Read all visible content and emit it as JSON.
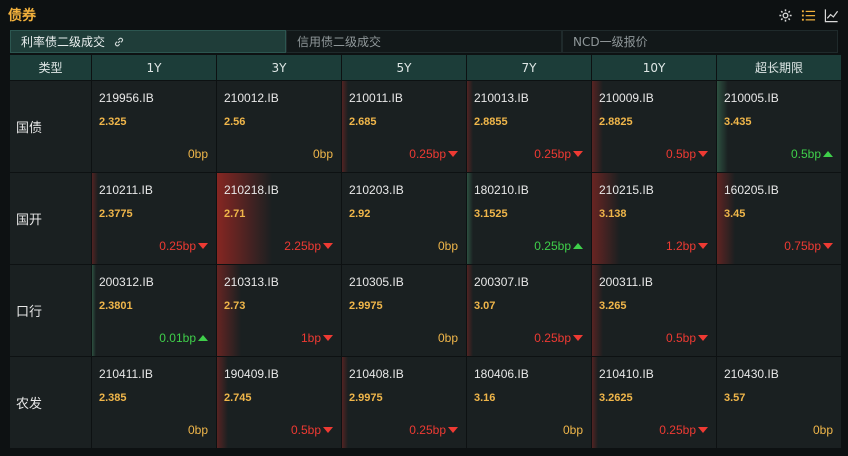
{
  "header": {
    "title": "债券"
  },
  "tabs": [
    {
      "label": "利率债二级成交",
      "active": true
    },
    {
      "label": "信用债二级成交",
      "active": false
    },
    {
      "label": "NCD一级报价",
      "active": false
    }
  ],
  "columns": [
    "类型",
    "1Y",
    "3Y",
    "5Y",
    "7Y",
    "10Y",
    "超长期限"
  ],
  "rows": [
    {
      "label": "国债",
      "cells": [
        {
          "code": "219956.IB",
          "yield": "2.325",
          "chg": "0bp",
          "dir": "flat",
          "intensity": 0
        },
        {
          "code": "210012.IB",
          "yield": "2.56",
          "chg": "0bp",
          "dir": "flat",
          "intensity": 0
        },
        {
          "code": "210011.IB",
          "yield": "2.685",
          "chg": "0.25bp",
          "dir": "down",
          "intensity": 0.1
        },
        {
          "code": "210013.IB",
          "yield": "2.8855",
          "chg": "0.25bp",
          "dir": "down",
          "intensity": 0.1
        },
        {
          "code": "210009.IB",
          "yield": "2.8825",
          "chg": "0.5bp",
          "dir": "down",
          "intensity": 0.2
        },
        {
          "code": "210005.IB",
          "yield": "3.435",
          "chg": "0.5bp",
          "dir": "up",
          "intensity": 0.2
        }
      ]
    },
    {
      "label": "国开",
      "cells": [
        {
          "code": "210211.IB",
          "yield": "2.3775",
          "chg": "0.25bp",
          "dir": "down",
          "intensity": 0.1
        },
        {
          "code": "210218.IB",
          "yield": "2.71",
          "chg": "2.25bp",
          "dir": "down",
          "intensity": 1.0
        },
        {
          "code": "210203.IB",
          "yield": "2.92",
          "chg": "0bp",
          "dir": "flat",
          "intensity": 0
        },
        {
          "code": "180210.IB",
          "yield": "3.1525",
          "chg": "0.25bp",
          "dir": "up",
          "intensity": 0.1
        },
        {
          "code": "210215.IB",
          "yield": "3.138",
          "chg": "1.2bp",
          "dir": "down",
          "intensity": 0.5
        },
        {
          "code": "160205.IB",
          "yield": "3.45",
          "chg": "0.75bp",
          "dir": "down",
          "intensity": 0.33
        }
      ]
    },
    {
      "label": "口行",
      "cells": [
        {
          "code": "200312.IB",
          "yield": "2.3801",
          "chg": "0.01bp",
          "dir": "up",
          "intensity": 0
        },
        {
          "code": "210313.IB",
          "yield": "2.73",
          "chg": "1bp",
          "dir": "down",
          "intensity": 0.44
        },
        {
          "code": "210305.IB",
          "yield": "2.9975",
          "chg": "0bp",
          "dir": "flat",
          "intensity": 0
        },
        {
          "code": "200307.IB",
          "yield": "3.07",
          "chg": "0.25bp",
          "dir": "down",
          "intensity": 0.1
        },
        {
          "code": "200311.IB",
          "yield": "3.265",
          "chg": "0.5bp",
          "dir": "down",
          "intensity": 0.2
        },
        {
          "code": "",
          "yield": "",
          "chg": "",
          "dir": "none",
          "intensity": 0
        }
      ]
    },
    {
      "label": "农发",
      "cells": [
        {
          "code": "210411.IB",
          "yield": "2.385",
          "chg": "0bp",
          "dir": "flat",
          "intensity": 0
        },
        {
          "code": "190409.IB",
          "yield": "2.745",
          "chg": "0.5bp",
          "dir": "down",
          "intensity": 0.2
        },
        {
          "code": "210408.IB",
          "yield": "2.9975",
          "chg": "0.25bp",
          "dir": "down",
          "intensity": 0.1
        },
        {
          "code": "180406.IB",
          "yield": "3.16",
          "chg": "0bp",
          "dir": "flat",
          "intensity": 0
        },
        {
          "code": "210410.IB",
          "yield": "3.2625",
          "chg": "0.25bp",
          "dir": "down",
          "intensity": 0.1
        },
        {
          "code": "210430.IB",
          "yield": "3.57",
          "chg": "0bp",
          "dir": "flat",
          "intensity": 0
        }
      ]
    }
  ],
  "colors": {
    "accent": "#f2b13c",
    "down": "#ee3a33",
    "up": "#3fcf4a",
    "header_bg": "#1c3d39"
  },
  "icons": [
    "gear-icon",
    "list-icon",
    "line-chart-icon",
    "link-icon"
  ]
}
